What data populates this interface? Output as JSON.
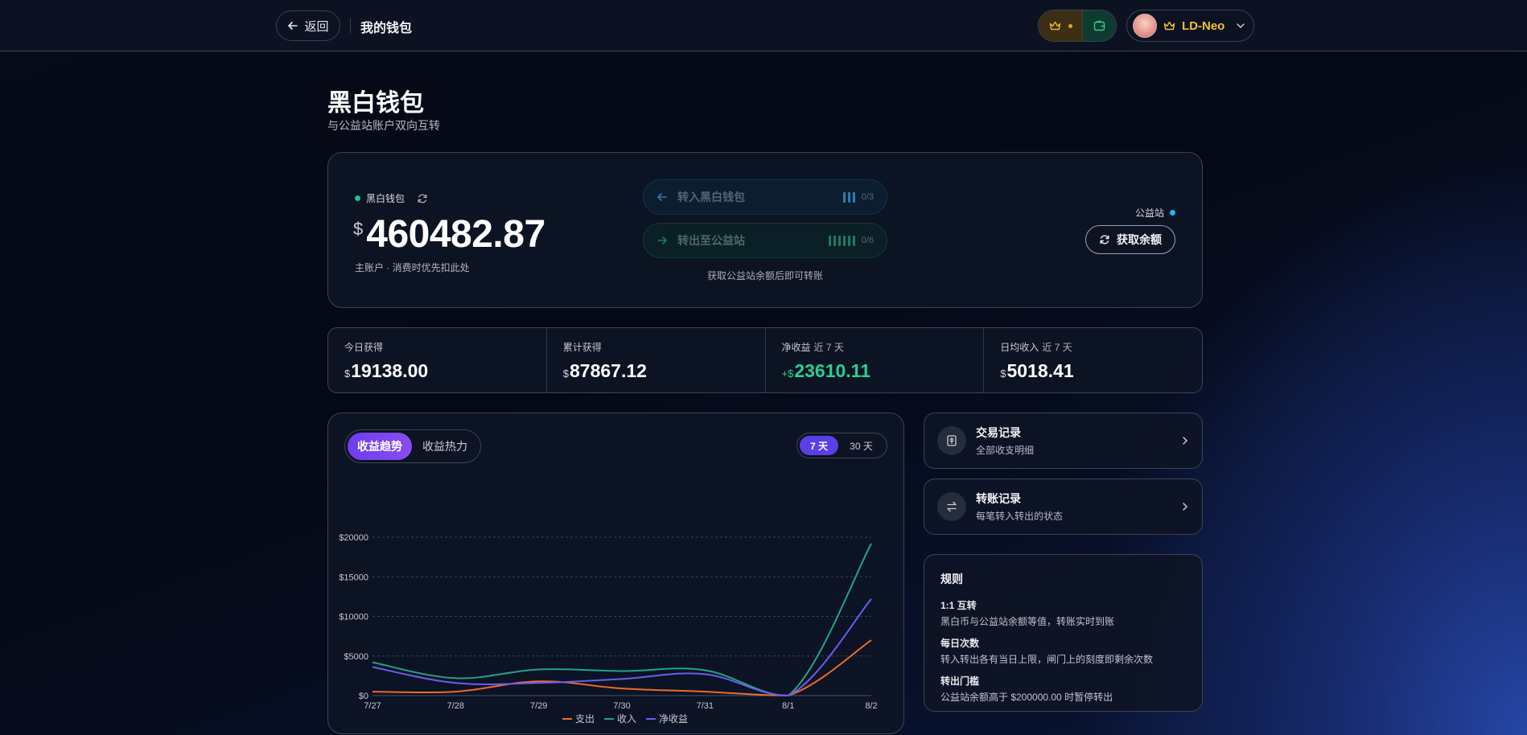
{
  "topbar": {
    "back_label": "返回",
    "page_name": "我的钱包",
    "user_name": "LD-Neo"
  },
  "header": {
    "title": "黑白钱包",
    "subtitle": "与公益站账户双向互转"
  },
  "wallet": {
    "label": "黑白钱包",
    "currency": "$",
    "balance": "460482.87",
    "note": "主账户 · 消费时优先扣此处",
    "transfer_in": {
      "label": "转入黑白钱包",
      "count": "0/3",
      "ticks": 3
    },
    "transfer_out": {
      "label": "转出至公益站",
      "count": "0/6",
      "ticks": 6
    },
    "hint": "获取公益站余额后即可转账",
    "site_label": "公益站",
    "fetch_label": "获取余额"
  },
  "stats": [
    {
      "label": "今日获得",
      "sub": "",
      "currency": "$",
      "value": "19138.00"
    },
    {
      "label": "累计获得",
      "sub": "",
      "currency": "$",
      "value": "87867.12"
    },
    {
      "label": "净收益",
      "sub": "近 7 天",
      "currency": "+$",
      "value": "23610.11"
    },
    {
      "label": "日均收入",
      "sub": "近 7 天",
      "currency": "$",
      "value": "5018.41"
    }
  ],
  "chart": {
    "tabs": [
      "收益趋势",
      "收益热力"
    ],
    "ranges": [
      "7 天",
      "30 天"
    ]
  },
  "links": {
    "transactions": {
      "title": "交易记录",
      "sub": "全部收支明细"
    },
    "transfers": {
      "title": "转账记录",
      "sub": "每笔转入转出的状态"
    }
  },
  "rules": {
    "title": "规则",
    "items": [
      {
        "heading": "1:1 互转",
        "desc": "黑白币与公益站余额等值，转账实时到账"
      },
      {
        "heading": "每日次数",
        "desc": "转入转出各有当日上限，闸门上的刻度即剩余次数"
      },
      {
        "heading": "转出门槛",
        "desc": "公益站余额高于 $200000.00 时暂停转出"
      }
    ]
  },
  "colors": {
    "expense": "#f06a2c",
    "income": "#1fa586",
    "net": "#6a5cf0"
  },
  "chart_data": {
    "type": "line",
    "categories": [
      "7/27",
      "7/28",
      "7/29",
      "7/30",
      "7/31",
      "8/1",
      "8/2"
    ],
    "y_tick_labels": [
      "$0",
      "$5000",
      "$10000",
      "$15000",
      "$20000"
    ],
    "ylim": [
      0,
      20000
    ],
    "grid": true,
    "legend_position": "bottom",
    "series": [
      {
        "name": "支出",
        "values": [
          500,
          500,
          1800,
          900,
          500,
          0,
          7000
        ]
      },
      {
        "name": "收入",
        "values": [
          4200,
          2200,
          3300,
          3100,
          3200,
          0,
          19200
        ]
      },
      {
        "name": "净收益",
        "values": [
          3600,
          1600,
          1600,
          2100,
          2700,
          0,
          12200
        ]
      }
    ]
  }
}
